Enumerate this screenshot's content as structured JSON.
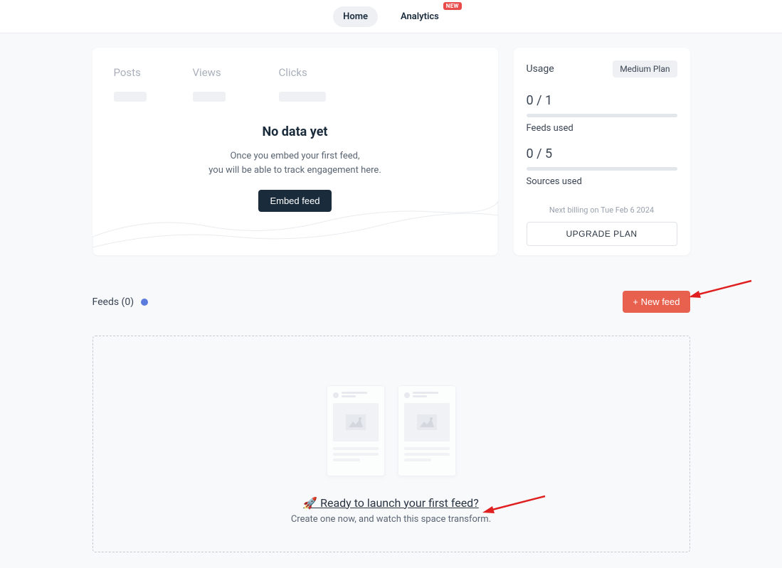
{
  "nav": {
    "home": "Home",
    "analytics": "Analytics",
    "new_badge": "NEW"
  },
  "metrics": {
    "posts_label": "Posts",
    "views_label": "Views",
    "clicks_label": "Clicks",
    "no_data_title": "No data yet",
    "no_data_line1": "Once you embed your first feed,",
    "no_data_line2": "you will be able to track engagement here.",
    "embed_btn": "Embed feed"
  },
  "usage": {
    "title": "Usage",
    "plan": "Medium Plan",
    "feeds_value": "0 / 1",
    "feeds_label": "Feeds used",
    "sources_value": "0 / 5",
    "sources_label": "Sources used",
    "billing": "Next billing on Tue Feb 6 2024",
    "upgrade": "UPGRADE PLAN"
  },
  "feeds": {
    "count_label": "Feeds (0)",
    "new_btn": "+ New feed",
    "launch_title": "🚀 Ready to launch your first feed?",
    "launch_desc": "Create one now, and watch this space transform."
  }
}
